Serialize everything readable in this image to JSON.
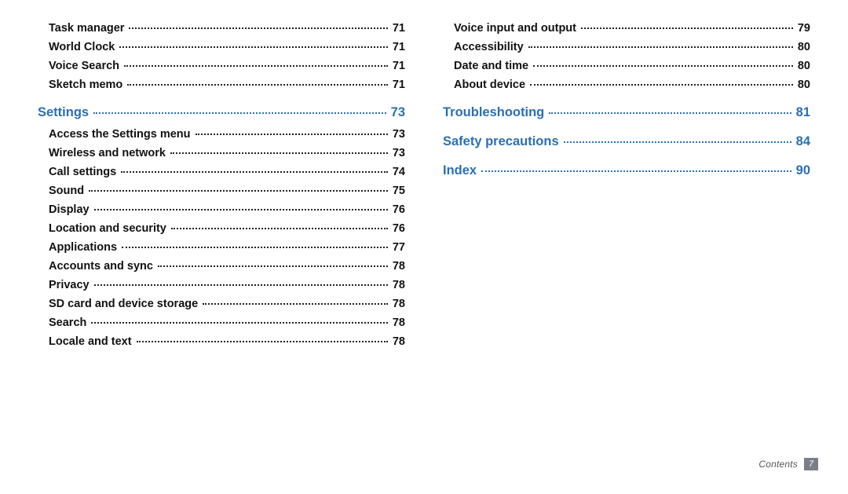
{
  "colors": {
    "section_heading": "#2a6fb5",
    "text": "#111"
  },
  "footer": {
    "label": "Contents",
    "page": "7"
  },
  "left_column": [
    {
      "type": "item",
      "label": "Task manager",
      "page": "71"
    },
    {
      "type": "item",
      "label": "World Clock",
      "page": "71"
    },
    {
      "type": "item",
      "label": "Voice Search",
      "page": "71"
    },
    {
      "type": "item",
      "label": "Sketch memo",
      "page": "71"
    },
    {
      "type": "section",
      "label": "Settings",
      "page": "73"
    },
    {
      "type": "item",
      "label": "Access the Settings menu",
      "page": "73"
    },
    {
      "type": "item",
      "label": "Wireless and network",
      "page": "73"
    },
    {
      "type": "item",
      "label": "Call settings",
      "page": "74"
    },
    {
      "type": "item",
      "label": "Sound",
      "page": "75"
    },
    {
      "type": "item",
      "label": "Display",
      "page": "76"
    },
    {
      "type": "item",
      "label": "Location and security",
      "page": "76"
    },
    {
      "type": "item",
      "label": "Applications",
      "page": "77"
    },
    {
      "type": "item",
      "label": "Accounts and sync",
      "page": "78"
    },
    {
      "type": "item",
      "label": "Privacy",
      "page": "78"
    },
    {
      "type": "item",
      "label": "SD card and device storage",
      "page": "78"
    },
    {
      "type": "item",
      "label": "Search",
      "page": "78"
    },
    {
      "type": "item",
      "label": "Locale and text",
      "page": "78"
    }
  ],
  "right_column": [
    {
      "type": "item",
      "label": "Voice input and output",
      "page": "79"
    },
    {
      "type": "item",
      "label": "Accessibility",
      "page": "80"
    },
    {
      "type": "item",
      "label": "Date and time",
      "page": "80"
    },
    {
      "type": "item",
      "label": "About device",
      "page": "80"
    },
    {
      "type": "section",
      "label": "Troubleshooting",
      "page": "81"
    },
    {
      "type": "section",
      "label": "Safety precautions",
      "page": "84"
    },
    {
      "type": "section",
      "label": "Index",
      "page": "90"
    }
  ]
}
